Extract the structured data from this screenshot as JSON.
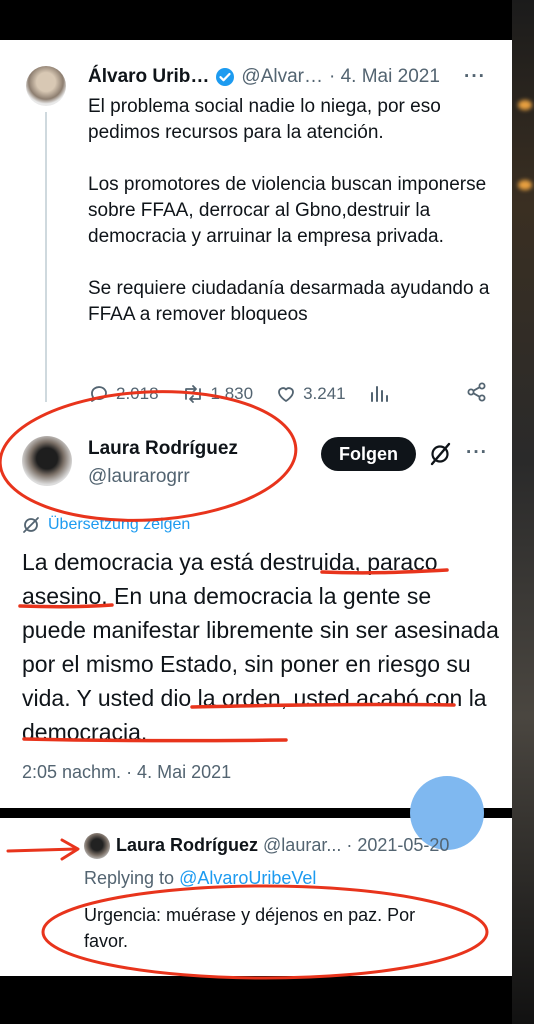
{
  "original_tweet": {
    "author_name": "Álvaro Urib…",
    "handle": "@Alvar…",
    "date": "· 4. Mai 2021",
    "more": "···",
    "paragraphs": [
      "El problema social nadie lo niega, por eso pedimos recursos para la atención.",
      "Los promotores de violencia buscan imponerse sobre FFAA, derrocar al Gbno,destruir la democracia y arruinar la empresa privada.",
      "Se requiere ciudadanía desarmada ayudando a FFAA a remover bloqueos"
    ],
    "actions": {
      "replies": "2.018",
      "retweets": "1.830",
      "likes": "3.241"
    }
  },
  "reply_tweet": {
    "author_name": "Laura Rodríguez",
    "handle": "@laurarogrr",
    "follow_label": "Folgen",
    "more": "···",
    "translate_label": "Übersetzung zeigen",
    "text": "La democracia ya está destruida, paraco asesino. En una democracia la gente se puede manifestar libremente sin ser asesinada por el mismo Estado, sin poner en riesgo su vida. Y usted dio la orden, usted acabó con la democracia.",
    "timestamp": "2:05 nachm. · 4. Mai 2021"
  },
  "bottom_tweet": {
    "author_name": "Laura Rodríguez",
    "handle": "@laurar...",
    "date": "· 2021-05-20",
    "replying_prefix": "Replying to",
    "replying_to": "@AlvaroUribeVel",
    "text": "Urgencia: muérase y déjenos en paz. Por favor."
  },
  "colors": {
    "annotation_red": "#e8341c",
    "link_blue": "#1d9bf0",
    "secondary_text": "#536471"
  }
}
